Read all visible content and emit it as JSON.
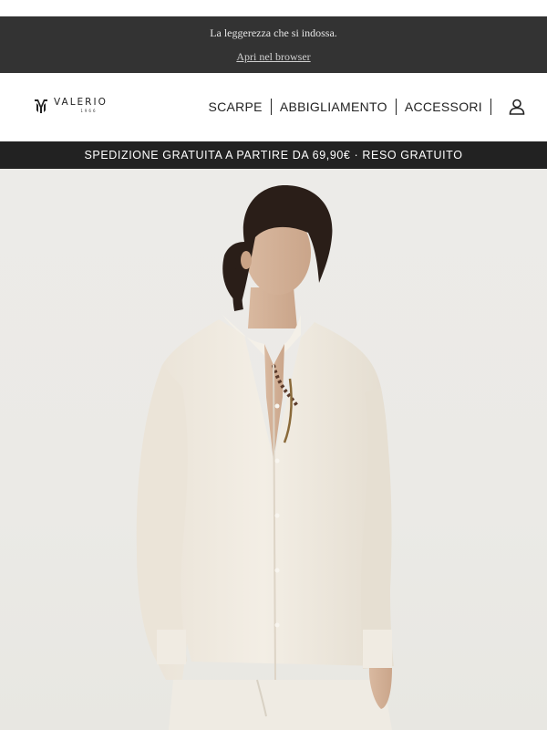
{
  "preheader": {
    "tagline": "La leggerezza che si indossa.",
    "browser_link": "Apri nel browser"
  },
  "brand": {
    "name": "VALERIO",
    "year": "1966"
  },
  "nav": {
    "items": [
      {
        "label": "SCARPE"
      },
      {
        "label": "ABBIGLIAMENTO"
      },
      {
        "label": "ACCESSORI"
      }
    ],
    "account_icon": "user-icon"
  },
  "shipping_bar": {
    "text": "SPEDIZIONE GRATUITA A PARTIRE DA 69,90€ · RESO GRATUITO"
  },
  "hero": {
    "image": "model-wearing-white-linen-shirt"
  },
  "colors": {
    "preheader_bg": "#333333",
    "bar_bg": "#222222",
    "hero_bg": "#ecebe8",
    "shirt": "#f2ede4"
  }
}
